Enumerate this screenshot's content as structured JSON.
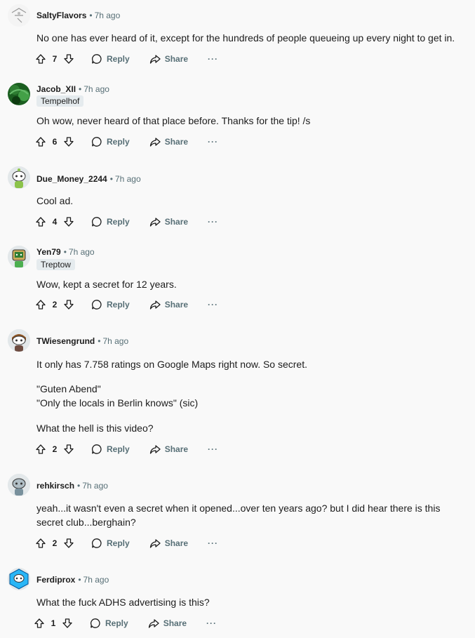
{
  "labels": {
    "reply": "Reply",
    "share": "Share",
    "more": "···"
  },
  "comments": [
    {
      "username": "SaltyFlavors",
      "time": "7h ago",
      "flair": "",
      "body": [
        "No one has ever heard of it, except for the hundreds of people queueing up every night to get in."
      ],
      "score": "7",
      "avatar": "avatar-sketch"
    },
    {
      "username": "Jacob_XII",
      "time": "7h ago",
      "flair": "Tempelhof",
      "body": [
        "Oh wow, never heard of that place before. Thanks for the tip! /s"
      ],
      "score": "6",
      "avatar": "avatar-green-pattern"
    },
    {
      "username": "Due_Money_2244",
      "time": "7h ago",
      "flair": "",
      "body": [
        "Cool ad."
      ],
      "score": "4",
      "avatar": "avatar-snoo-green"
    },
    {
      "username": "Yen79",
      "time": "7h ago",
      "flair": "Treptow",
      "body": [
        "Wow, kept a secret for 12 years."
      ],
      "score": "2",
      "avatar": "avatar-snoo-robot"
    },
    {
      "username": "TWiesengrund",
      "time": "7h ago",
      "flair": "",
      "body": [
        "It only has 7.758 ratings on Google Maps right now. So secret.",
        "\"Guten Abend\"",
        "\"Only the locals in Berlin knows\" (sic)",
        "What the hell is this video?"
      ],
      "score": "2",
      "avatar": "avatar-snoo-brown"
    },
    {
      "username": "rehkirsch",
      "time": "7h ago",
      "flair": "",
      "body": [
        "yeah...it wasn't even a secret when it opened...over ten years ago? but I did hear there is this secret club...berghain?"
      ],
      "score": "2",
      "avatar": "avatar-snoo-gray"
    },
    {
      "username": "Ferdiprox",
      "time": "7h ago",
      "flair": "",
      "body": [
        "What the fuck ADHS advertising is this?"
      ],
      "score": "1",
      "avatar": "avatar-snoo-blue"
    }
  ]
}
